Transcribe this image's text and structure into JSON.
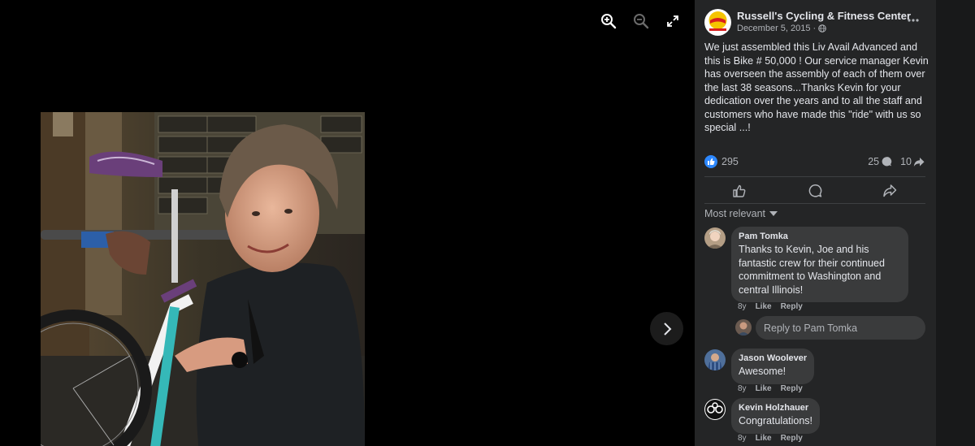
{
  "viewer": {
    "tools": [
      "zoom-in-icon",
      "zoom-out-icon",
      "expand-icon"
    ],
    "next_icon": "chevron-right-icon"
  },
  "post": {
    "page_name": "Russell's Cycling & Fitness Center",
    "date": "December 5, 2015",
    "privacy_icon": "globe-icon",
    "text": "We just assembled this Liv Avail Advanced and this is Bike # 50,000 ! Our service manager Kevin has overseen the assembly of each of them over the last 38 seasons...Thanks Kevin for your dedication over the years and to all the staff and customers who have made this \"ride\" with us so special ...!",
    "reaction_count": "295",
    "comment_count": "25",
    "share_count": "10",
    "accent": "#2d88ff"
  },
  "actions": [
    "like-icon",
    "comment-icon",
    "share-icon"
  ],
  "sort_label": "Most relevant",
  "comments": [
    {
      "author": "Pam Tomka",
      "text": "Thanks to Kevin, Joe and his fantastic crew for their continued commitment to Washington and central Illinois!",
      "age": "8y",
      "like": "Like",
      "reply": "Reply"
    },
    {
      "author": "Jason Woolever",
      "text": "Awesome!",
      "age": "8y",
      "like": "Like",
      "reply": "Reply"
    },
    {
      "author": "Kevin Holzhauer",
      "text": "Congratulations!",
      "age": "8y",
      "like": "Like",
      "reply": "Reply"
    }
  ],
  "reply_placeholder": "Reply to Pam Tomka"
}
